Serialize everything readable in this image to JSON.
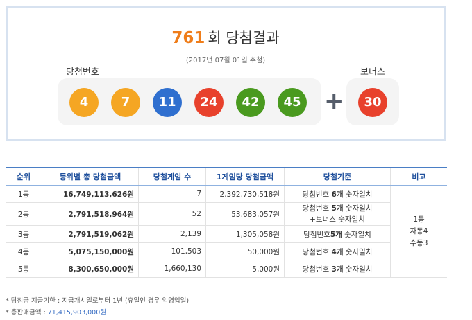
{
  "header": {
    "round": "761",
    "round_suffix": "회 당첨결과",
    "draw_date": "(2017년 07월 01일 추첨)"
  },
  "labels": {
    "winning_numbers": "당첨번호",
    "bonus": "보너스",
    "plus": "+"
  },
  "balls": [
    {
      "number": "4",
      "color": "#f5a623"
    },
    {
      "number": "7",
      "color": "#f5a623"
    },
    {
      "number": "11",
      "color": "#2f6fcf"
    },
    {
      "number": "24",
      "color": "#e8412c"
    },
    {
      "number": "42",
      "color": "#4a9a1f"
    },
    {
      "number": "45",
      "color": "#4a9a1f"
    }
  ],
  "bonus_ball": {
    "number": "30",
    "color": "#e8412c"
  },
  "table": {
    "headers": [
      "순위",
      "등위별 총 당첨금액",
      "당첨게임 수",
      "1게임당 당첨금액",
      "당첨기준",
      "비고"
    ],
    "rows": [
      {
        "rank": "1등",
        "total": "16,749,113,626원",
        "games": "7",
        "per_game": "2,392,730,518원",
        "crit_prefix": "당첨번호 ",
        "crit_bold": "6개",
        "crit_suffix": " 숫자일치",
        "crit_line2": ""
      },
      {
        "rank": "2등",
        "total": "2,791,518,964원",
        "games": "52",
        "per_game": "53,683,057원",
        "crit_prefix": "당첨번호 ",
        "crit_bold": "5개",
        "crit_suffix": " 숫자일치",
        "crit_line2": "+보너스 숫자일치"
      },
      {
        "rank": "3등",
        "total": "2,791,519,062원",
        "games": "2,139",
        "per_game": "1,305,058원",
        "crit_prefix": "당첨번호",
        "crit_bold": "5개",
        "crit_suffix": " 숫자일치",
        "crit_line2": ""
      },
      {
        "rank": "4등",
        "total": "5,075,150,000원",
        "games": "101,503",
        "per_game": "50,000원",
        "crit_prefix": "당첨번호 ",
        "crit_bold": "4개",
        "crit_suffix": " 숫자일치",
        "crit_line2": ""
      },
      {
        "rank": "5등",
        "total": "8,300,650,000원",
        "games": "1,660,130",
        "per_game": "5,000원",
        "crit_prefix": "당첨번호 ",
        "crit_bold": "3개",
        "crit_suffix": " 숫자일치",
        "crit_line2": ""
      }
    ],
    "note_lines": [
      "1등",
      "자동4",
      "수동3"
    ]
  },
  "footnotes": {
    "payment_deadline": "* 당첨금 지급기한 : 지급개시일로부터 1년 (휴일인 경우 익영업일)",
    "total_sales_label": "* 총판매금액 : ",
    "total_sales_amount": "71,415,903,000원"
  }
}
